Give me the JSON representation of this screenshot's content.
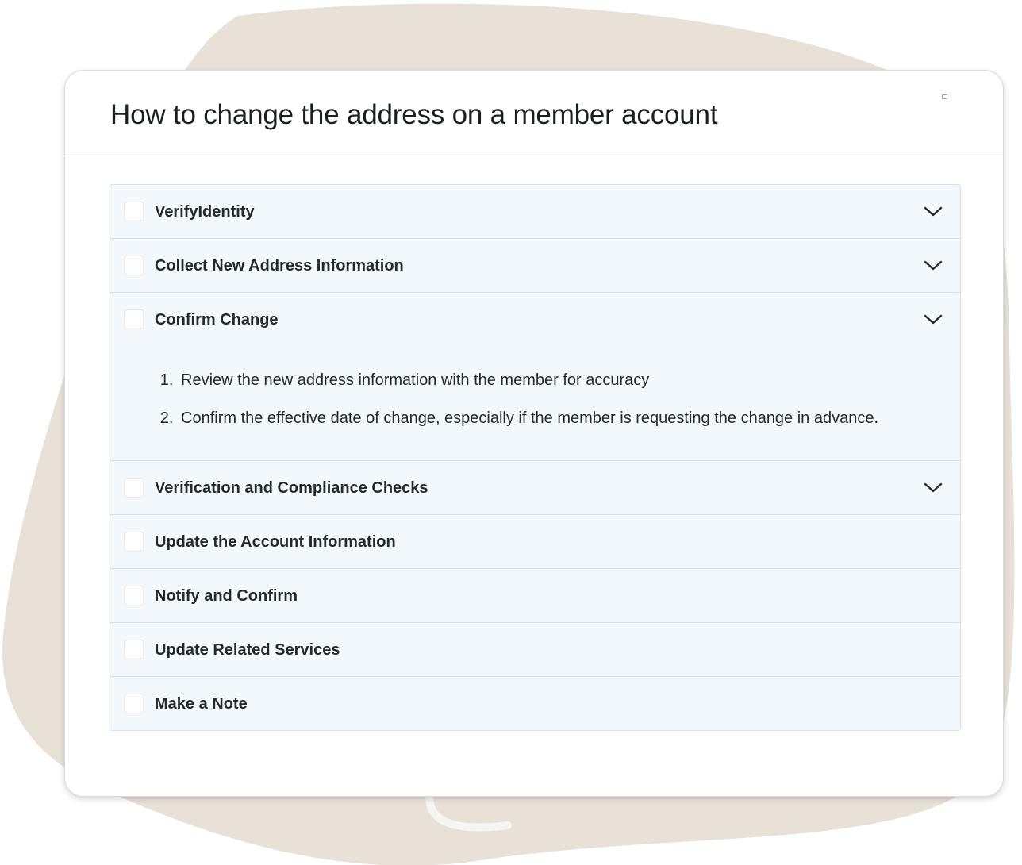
{
  "page": {
    "title": "How to change the address on a member account"
  },
  "colors": {
    "blob": "#e8e1d8",
    "accordion_bg": "#f3f8fc",
    "border": "#d8e0e8",
    "text": "#24292f"
  },
  "sections": [
    {
      "label": "VerifyIdentity",
      "chevron": "chevron-down-icon"
    },
    {
      "label": "Collect New Address Information",
      "chevron": "chevron-down-icon"
    },
    {
      "label": "Confirm Change",
      "chevron": "chevron-down-icon",
      "expanded": true,
      "steps": [
        "Review the new address information with the member for accuracy",
        "Confirm the effective date of change, especially if the member is requesting the change in advance."
      ]
    },
    {
      "label": "Verification and Compliance Checks",
      "chevron": "chevron-down-icon"
    },
    {
      "label": "Update the Account Information"
    },
    {
      "label": "Notify and Confirm"
    },
    {
      "label": "Update Related Services"
    },
    {
      "label": "Make a Note"
    }
  ]
}
